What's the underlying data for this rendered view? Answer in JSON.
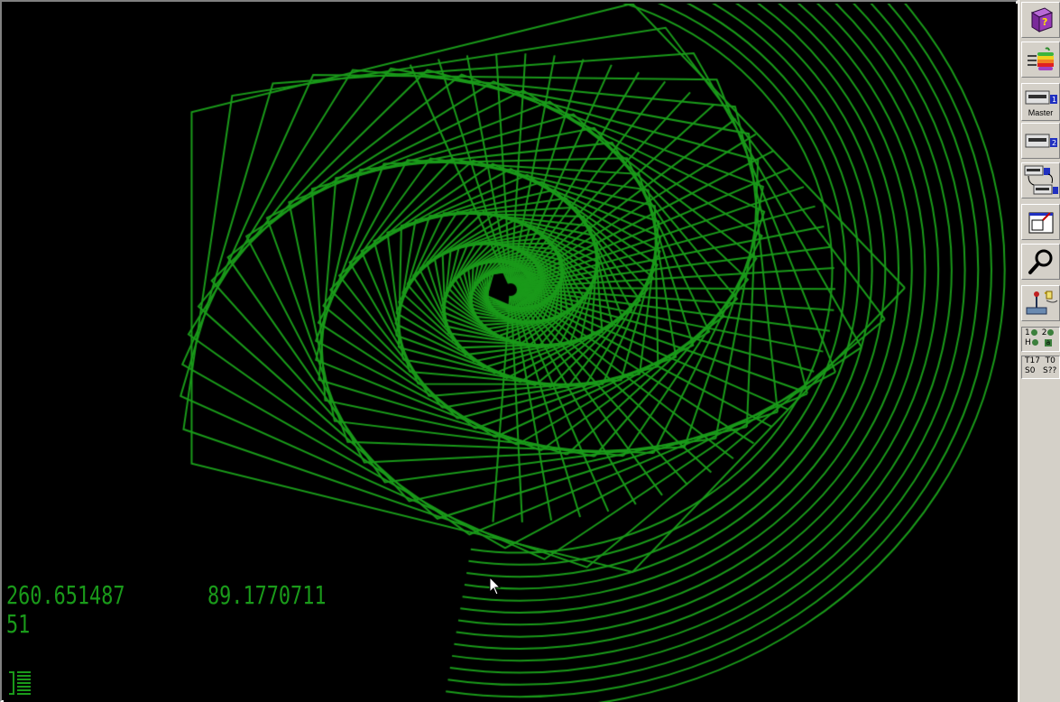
{
  "screen": {
    "readout_a": "260.651487",
    "readout_b": "89.1770711",
    "readout_c": "51",
    "fg_color": "#1a9a1a",
    "bg_color": "#000000"
  },
  "toolbar": {
    "buttons": [
      {
        "icon": "help-book-icon"
      },
      {
        "icon": "apple-run-icon"
      },
      {
        "icon": "disk-drive-1-icon",
        "label": "Master"
      },
      {
        "icon": "disk-drive-2-icon"
      },
      {
        "icon": "swap-disks-icon"
      },
      {
        "icon": "fullscreen-icon"
      },
      {
        "icon": "debugger-magnifier-icon"
      },
      {
        "icon": "settings-joystick-icon"
      }
    ],
    "leds": {
      "drive1_label": "1",
      "drive2_label": "2",
      "hdd_label": "H",
      "mode_label": "a"
    },
    "status": {
      "line1": "T17  T0",
      "line2": "S0   S??"
    }
  }
}
